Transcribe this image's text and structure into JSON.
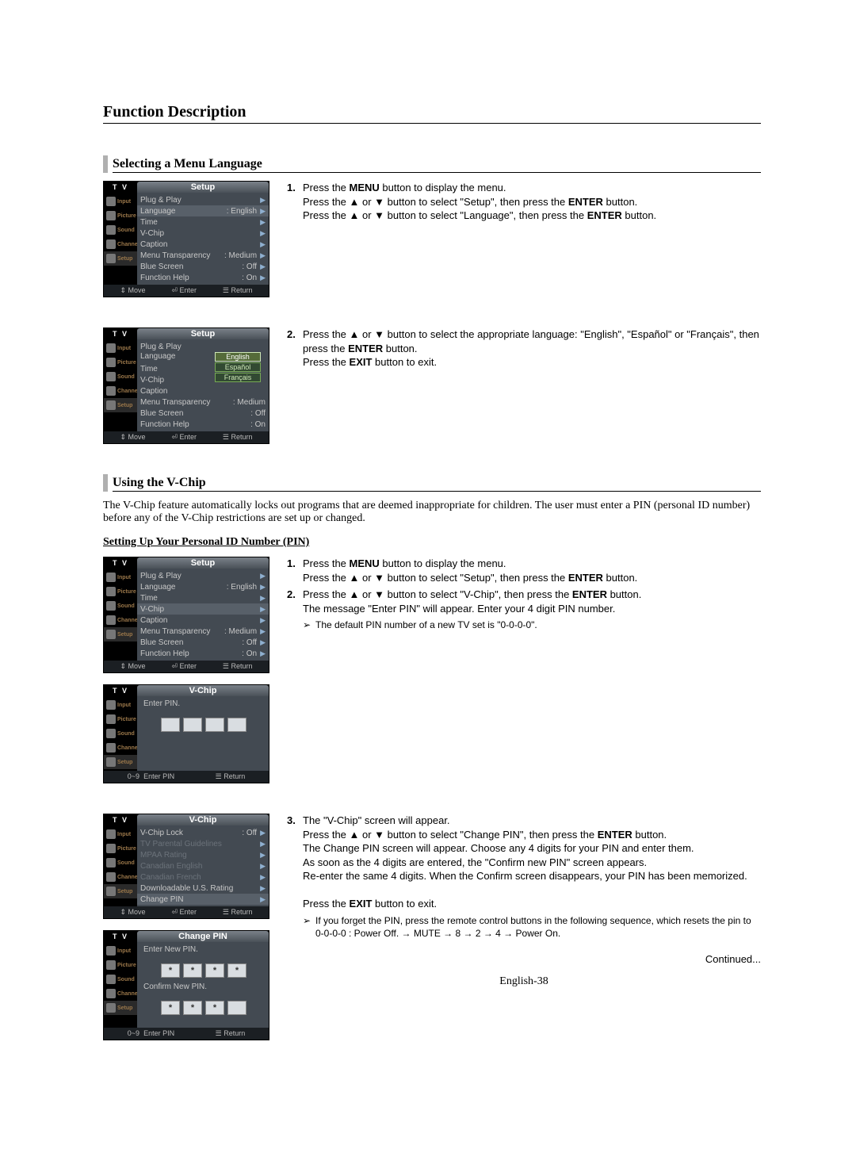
{
  "h1": "Function Description",
  "h2a": "Selecting a Menu Language",
  "h2b": "Using the V-Chip",
  "intro": "The V-Chip feature automatically locks out programs that are deemed inappropriate for children. The user must enter a PIN (personal ID number) before any of the V-Chip restrictions are set up or changed.",
  "subhead": "Setting Up Your Personal ID Number (PIN)",
  "continued": "Continued...",
  "pagenum": "English-38",
  "steps_lang": {
    "s1a": "Press the ",
    "s1b": " button to display the menu.",
    "s1c": "Press the ▲ or ▼ button to select \"Setup\", then press the ",
    "s1d": " button.",
    "s1e": "Press the ▲ or ▼ button to select \"Language\", then press the ",
    "s1f": " button.",
    "s2a": "Press the ▲ or ▼ button to select the appropriate language: \"English\", \"Español\" or \"Français\", then press the ",
    "s2b": " button.",
    "s2c": "Press the ",
    "s2d": " button to exit."
  },
  "steps_vchip": {
    "s1a": "Press the ",
    "s1b": " button to display the menu.",
    "s1c": "Press the ▲ or ▼ button to select \"Setup\", then press the ",
    "s1d": " button.",
    "s2a": "Press the ▲ or ▼ button to select \"V-Chip\", then press the ",
    "s2b": " button.",
    "s2c": "The message \"Enter PIN\" will appear. Enter your 4 digit PIN number.",
    "note1": "The default PIN number of a new TV set is \"0-0-0-0\".",
    "s3a": "The \"V-Chip\" screen will appear.",
    "s3b": "Press the ▲ or ▼ button to select \"Change PIN\", then press the ",
    "s3c": " button.",
    "s3d": "The Change PIN screen will appear. Choose any 4 digits for your PIN and enter them.",
    "s3e": "As soon as the 4 digits are entered, the \"Confirm new PIN\" screen appears.",
    "s3f": "Re-enter the same 4 digits. When the Confirm screen disappears, your PIN has been memorized.",
    "s3g": "Press the ",
    "s3h": " button to exit.",
    "note2": "If you forget the PIN, press the remote control buttons in the following sequence, which resets the pin to 0-0-0-0 : Power Off. → MUTE → 8 → 2 → 4 → Power On."
  },
  "bold": {
    "MENU": "MENU",
    "ENTER": "ENTER",
    "EXIT": "EXIT"
  },
  "ui": {
    "tv": "T V",
    "titles": {
      "setup": "Setup",
      "vchip": "V-Chip",
      "changepin": "Change PIN"
    },
    "sidebar": {
      "input": "Input",
      "picture": "Picture",
      "sound": "Sound",
      "channel": "Channel",
      "setup": "Setup"
    },
    "setup_rows": {
      "plugplay": "Plug & Play",
      "language": "Language",
      "language_val": ": English",
      "time": "Time",
      "vchip": "V-Chip",
      "caption": "Caption",
      "transparency": "Menu Transparency",
      "transparency_val": ": Medium",
      "bluescreen": "Blue Screen",
      "bluescreen_val": ": Off",
      "functionhelp": "Function Help",
      "functionhelp_val": ": On"
    },
    "lang_opts": {
      "en": "English",
      "es": "Español",
      "fr": "Français"
    },
    "vchip_rows": {
      "lock": "V-Chip Lock",
      "lock_val": ": Off",
      "tvpg": "TV Parental Guidelines",
      "mpaa": "MPAA Rating",
      "caen": "Canadian English",
      "cafr": "Canadian French",
      "dlus": "Downloadable U.S. Rating",
      "change": "Change PIN"
    },
    "enterpin": "Enter PIN.",
    "newpin": "Enter New PIN.",
    "confirmpin": "Confirm New PIN.",
    "star": "*",
    "bottombars": {
      "move": "Move",
      "enter": "Enter",
      "return": "Return",
      "enterpin": "Enter PIN",
      "nums": "0~9"
    }
  }
}
